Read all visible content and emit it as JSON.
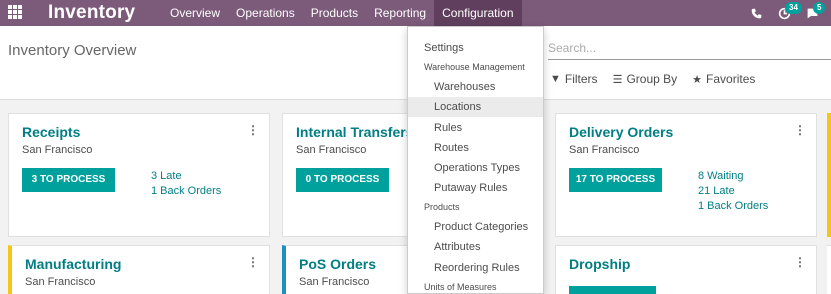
{
  "navbar": {
    "brand": "Inventory",
    "menu": [
      "Overview",
      "Operations",
      "Products",
      "Reporting",
      "Configuration"
    ],
    "active": "Configuration",
    "activity_count": "34",
    "messages_count": "5"
  },
  "control": {
    "title": "Inventory Overview",
    "search_placeholder": "Search...",
    "filters_label": "Filters",
    "groupby_label": "Group By",
    "favorites_label": "Favorites"
  },
  "cards": [
    {
      "title": "Receipts",
      "subtitle": "San Francisco",
      "button": "3 TO PROCESS",
      "stats": [
        "3 Late",
        "1 Back Orders"
      ]
    },
    {
      "title": "Internal Transfers",
      "subtitle": "San Francisco",
      "button": "0 TO PROCESS",
      "stats": []
    },
    {
      "title": "Delivery Orders",
      "subtitle": "San Francisco",
      "button": "17 TO PROCESS",
      "stats": [
        "8 Waiting",
        "21 Late",
        "1 Back Orders"
      ]
    },
    {
      "title": "Manufacturing",
      "subtitle": "San Francisco"
    },
    {
      "title": "PoS Orders",
      "subtitle": "San Francisco"
    },
    {
      "title": "Dropship",
      "subtitle": ""
    }
  ],
  "dropdown": {
    "settings": "Settings",
    "warehouse_header": "Warehouse Management",
    "warehouse_items": [
      "Warehouses",
      "Locations",
      "Rules",
      "Routes",
      "Operations Types",
      "Putaway Rules"
    ],
    "products_header": "Products",
    "product_items": [
      "Product Categories",
      "Attributes",
      "Reordering Rules"
    ],
    "units_header": "Units of Measures",
    "hovered": "Locations"
  },
  "icons": {
    "apps": "apps-grid-icon",
    "phone": "phone-icon",
    "activity": "clock-icon",
    "messages": "chat-icon",
    "filter": "funnel-icon",
    "groupby": "list-icon",
    "favorites": "star-icon",
    "card_menu": "kebab-menu-icon"
  },
  "colors": {
    "navbar": "#7c5a7a",
    "navbar_active": "#5f3f5d",
    "accent": "#00a09d",
    "title_teal": "#017e84"
  }
}
